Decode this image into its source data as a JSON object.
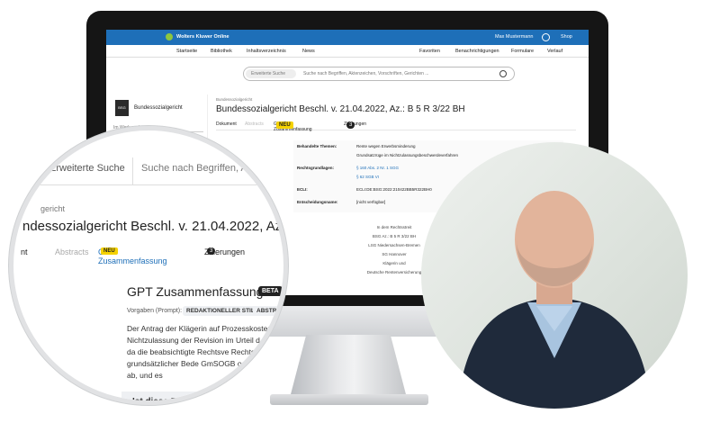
{
  "app": {
    "brand": "Wolters Kluwer Online",
    "user": "Max Mustermann",
    "shop": "Shop"
  },
  "nav": {
    "items": [
      "Startseite",
      "Bibliothek",
      "Inhaltsverzeichnis",
      "News"
    ],
    "right": [
      "Favoriten",
      "Benachrichtigungen",
      "Formulare",
      "Verlauf"
    ]
  },
  "search": {
    "scope": "Erweiterte Suche",
    "placeholder": "Suche nach Begriffen, Aktenzeichen, Vorschriften, Gerichten ..."
  },
  "sidebar": {
    "title": "Bundessozialgericht",
    "search_placeholder": "Im Werk suchen ..."
  },
  "document": {
    "breadcrumb": "Bundessozialgericht",
    "title": "Bundessozialgericht Beschl. v. 21.04.2022, Az.: B 5 R 3/22 BH",
    "tabs": [
      "Dokument",
      "Abstracts",
      "GPT Zusammenfassung",
      "Zitierungen"
    ],
    "tab_badge_new": "NEU",
    "citations_count": "3",
    "meta": {
      "topics_label": "Behandelte Themen:",
      "topics": [
        "Rente wegen Erwerbsminderung",
        "Grundsatzrüge im Nichtzulassungsbeschwerdeverfahren"
      ],
      "legal_label": "Rechtsgrundlagen:",
      "legal": [
        "§ 160 Abs. 2 Nr. 1 SGG",
        "§ 62 SGB VI"
      ],
      "ecli_label": "ECLI:",
      "ecli": "ECLI:DE:BSG:2022:210422BB5R322BH0",
      "decision_label": "Entscheidungsname:",
      "decision": "[nicht verfügbar]"
    },
    "content_lines": [
      "In dem Rechtsstreit",
      "BSG Az.: B 5 R 3/22 BH",
      "LSG Niedersachsen-Bremen",
      "SG Hannover",
      "Klägerin und",
      "Deutsche Rentenversicherung"
    ]
  },
  "zoom": {
    "search_scope": "Erweiterte Suche",
    "search_placeholder": "Suche nach Begriffen, Ak",
    "crumb": "gericht",
    "title": "ndessozialgericht Beschl. v. 21.04.2022, Az",
    "tabs": [
      "Abstracts",
      "GPT Zusammenfassung",
      "Zitierungen"
    ],
    "tab_first": "nt",
    "badge_new": "NEU",
    "citations": "3",
    "gpt_title": "GPT Zusammenfassung *",
    "beta": "BETA",
    "vorgaben": "Vorgaben (Prompt):",
    "chip1": "REDAKTIONELLER STIL",
    "chip2": "ABSTRACT",
    "paragraph": "Der Antrag der Klägerin auf Prozesskostenhi die Nichtzulassung der Revision im Urteil d abgelehnt, da die beabsichtigte Rechtsve Rechtsfragen von grundsätzlicher Bede GmSOGB oder des BVerfG ab, und es",
    "bottom": "Ist diese Zu"
  }
}
